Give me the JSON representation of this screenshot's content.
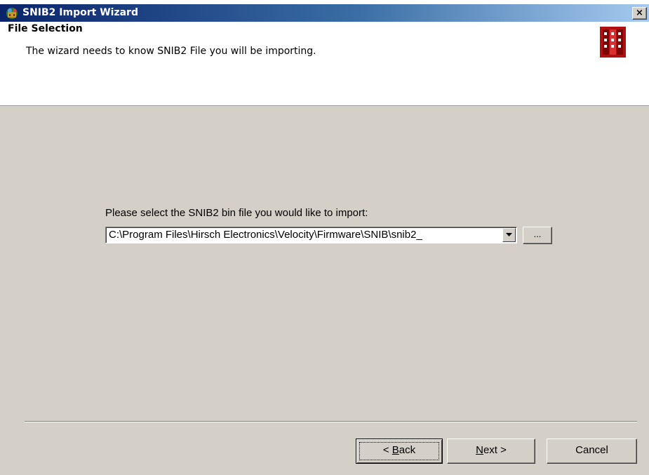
{
  "window": {
    "title": "SNIB2 Import Wizard",
    "close_label": "×"
  },
  "header": {
    "title": "File Selection",
    "description": "The wizard needs to know SNIB2 File you will be importing.",
    "logo_color": "#b01010"
  },
  "form": {
    "prompt": "Please select the SNIB2 bin file you would like to import:",
    "file_path": "C:\\Program Files\\Hirsch Electronics\\Velocity\\Firmware\\SNIB\\snib2_",
    "browse_label": "..."
  },
  "buttons": {
    "back_prefix": "< ",
    "back_mnemonic": "B",
    "back_rest": "ack",
    "next_mnemonic": "N",
    "next_rest": "ext >",
    "cancel": "Cancel"
  },
  "colors": {
    "titlebar_start": "#0a246a",
    "titlebar_end": "#a6caf0",
    "dialog_face": "#d4d0c8"
  }
}
